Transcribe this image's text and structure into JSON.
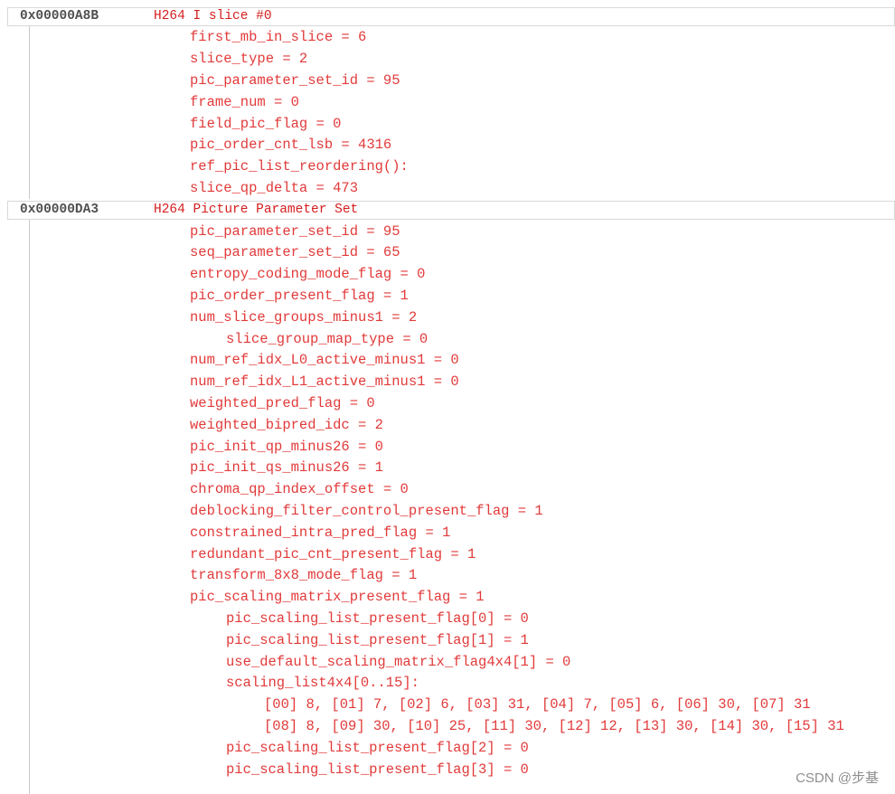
{
  "lines": [
    {
      "kind": "header",
      "address": "0x00000A8B",
      "text": "H264 I slice #0"
    },
    {
      "kind": "field",
      "depth": 1,
      "text": "first_mb_in_slice = 6"
    },
    {
      "kind": "field",
      "depth": 1,
      "text": "slice_type = 2"
    },
    {
      "kind": "field",
      "depth": 1,
      "text": "pic_parameter_set_id = 95"
    },
    {
      "kind": "field",
      "depth": 1,
      "text": "frame_num = 0"
    },
    {
      "kind": "field",
      "depth": 1,
      "text": "field_pic_flag = 0"
    },
    {
      "kind": "field",
      "depth": 1,
      "text": "pic_order_cnt_lsb = 4316"
    },
    {
      "kind": "field",
      "depth": 1,
      "text": "ref_pic_list_reordering():"
    },
    {
      "kind": "field",
      "depth": 1,
      "text": "slice_qp_delta = 473"
    },
    {
      "kind": "header",
      "address": "0x00000DA3",
      "text": "H264 Picture Parameter Set"
    },
    {
      "kind": "field",
      "depth": 1,
      "text": "pic_parameter_set_id = 95"
    },
    {
      "kind": "field",
      "depth": 1,
      "text": "seq_parameter_set_id = 65"
    },
    {
      "kind": "field",
      "depth": 1,
      "text": "entropy_coding_mode_flag = 0"
    },
    {
      "kind": "field",
      "depth": 1,
      "text": "pic_order_present_flag = 1"
    },
    {
      "kind": "field",
      "depth": 1,
      "text": "num_slice_groups_minus1 = 2"
    },
    {
      "kind": "field",
      "depth": 2,
      "text": "slice_group_map_type = 0"
    },
    {
      "kind": "field",
      "depth": 1,
      "text": "num_ref_idx_L0_active_minus1 = 0"
    },
    {
      "kind": "field",
      "depth": 1,
      "text": "num_ref_idx_L1_active_minus1 = 0"
    },
    {
      "kind": "field",
      "depth": 1,
      "text": "weighted_pred_flag = 0"
    },
    {
      "kind": "field",
      "depth": 1,
      "text": "weighted_bipred_idc = 2"
    },
    {
      "kind": "field",
      "depth": 1,
      "text": "pic_init_qp_minus26 = 0"
    },
    {
      "kind": "field",
      "depth": 1,
      "text": "pic_init_qs_minus26 = 1"
    },
    {
      "kind": "field",
      "depth": 1,
      "text": "chroma_qp_index_offset = 0"
    },
    {
      "kind": "field",
      "depth": 1,
      "text": "deblocking_filter_control_present_flag = 1"
    },
    {
      "kind": "field",
      "depth": 1,
      "text": "constrained_intra_pred_flag = 1"
    },
    {
      "kind": "field",
      "depth": 1,
      "text": "redundant_pic_cnt_present_flag = 1"
    },
    {
      "kind": "field",
      "depth": 1,
      "text": "transform_8x8_mode_flag = 1"
    },
    {
      "kind": "field",
      "depth": 1,
      "text": "pic_scaling_matrix_present_flag = 1"
    },
    {
      "kind": "field",
      "depth": 2,
      "text": "pic_scaling_list_present_flag[0] = 0"
    },
    {
      "kind": "field",
      "depth": 2,
      "text": "pic_scaling_list_present_flag[1] = 1"
    },
    {
      "kind": "field",
      "depth": 2,
      "text": "use_default_scaling_matrix_flag4x4[1] = 0"
    },
    {
      "kind": "field",
      "depth": 2,
      "text": "scaling_list4x4[0..15]:"
    },
    {
      "kind": "field",
      "depth": 3,
      "text": "[00] 8, [01] 7, [02] 6, [03] 31, [04] 7, [05] 6, [06] 30, [07] 31"
    },
    {
      "kind": "field",
      "depth": 3,
      "text": "[08] 8, [09] 30, [10] 25, [11] 30, [12] 12, [13] 30, [14] 30, [15] 31"
    },
    {
      "kind": "field",
      "depth": 2,
      "text": "pic_scaling_list_present_flag[2] = 0"
    },
    {
      "kind": "field",
      "depth": 2,
      "text": "pic_scaling_list_present_flag[3] = 0"
    }
  ],
  "watermark": "CSDN @步基",
  "colors": {
    "field_text": "#e23a3a",
    "header_title": "#d51e1e",
    "address": "#505050",
    "header_border": "#d8d8d8"
  }
}
